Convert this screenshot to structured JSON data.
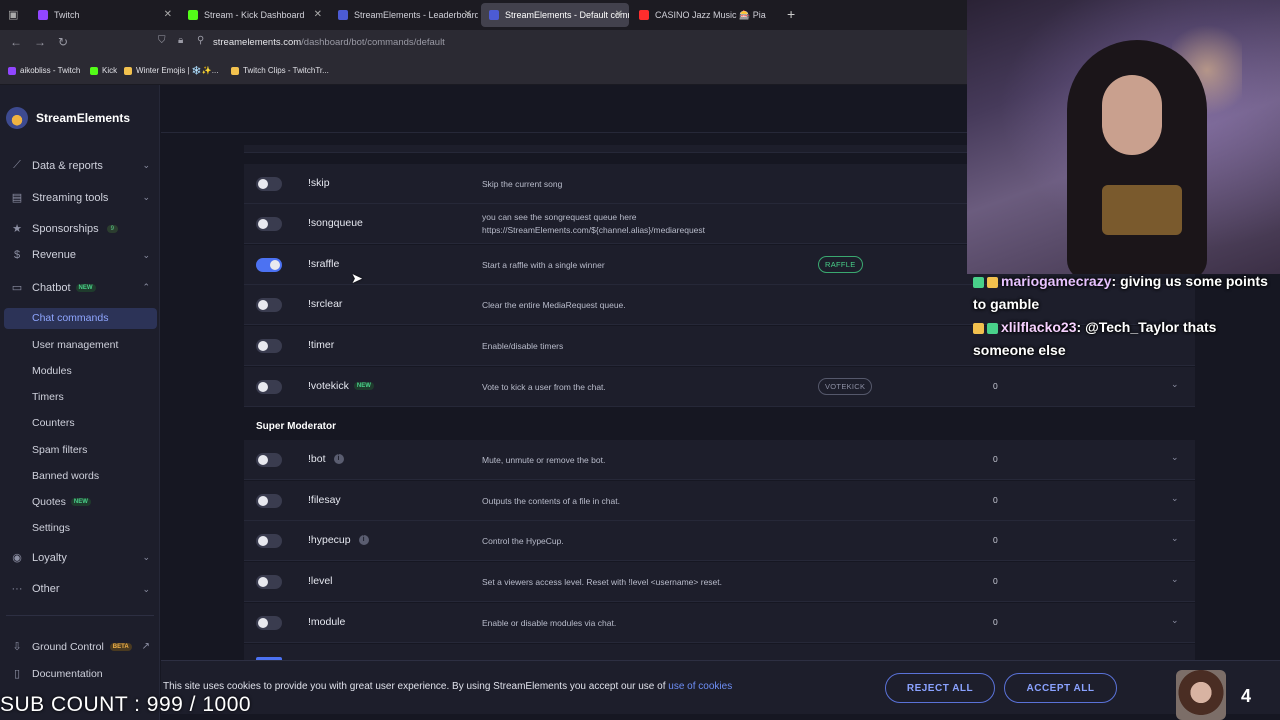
{
  "browser": {
    "tabs": [
      {
        "label": "Twitch",
        "color": "#9146ff"
      },
      {
        "label": "Stream - Kick Dashboard",
        "color": "#53fc18"
      },
      {
        "label": "StreamElements - Leaderboard",
        "color": "#4c5bd4"
      },
      {
        "label": "StreamElements - Default comm",
        "color": "#4c5bd4"
      },
      {
        "label": "CASINO Jazz Music 🎰 Pia",
        "color": "#ff2d2d"
      }
    ],
    "url_host": "streamelements.com",
    "url_path": "/dashboard/bot/commands/default",
    "bookmarks": [
      {
        "label": "aikobliss - Twitch",
        "color": "#9146ff"
      },
      {
        "label": "Kick",
        "color": "#53fc18"
      },
      {
        "label": "Winter Emojis | ❄️✨...",
        "color": "#f2c14e"
      },
      {
        "label": "Twitch Clips - TwitchTr...",
        "color": "#f2c14e"
      }
    ]
  },
  "sidebar": {
    "brand": "StreamElements",
    "sections": [
      {
        "label": "Data & reports",
        "icon": "chart-icon"
      },
      {
        "label": "Streaming tools",
        "icon": "tools-icon"
      },
      {
        "label": "Sponsorships",
        "icon": "star-icon",
        "count": "9"
      },
      {
        "label": "Revenue",
        "icon": "dollar-icon"
      },
      {
        "label": "Chatbot",
        "icon": "chat-icon",
        "badge": "NEW"
      }
    ],
    "chatbot_items": [
      {
        "label": "Chat commands"
      },
      {
        "label": "User management"
      },
      {
        "label": "Modules"
      },
      {
        "label": "Timers"
      },
      {
        "label": "Counters"
      },
      {
        "label": "Spam filters"
      },
      {
        "label": "Banned words"
      },
      {
        "label": "Quotes",
        "badge": "NEW"
      },
      {
        "label": "Settings"
      }
    ],
    "loyalty": "Loyalty",
    "other": "Other",
    "ground_control": "Ground Control",
    "ground_control_badge": "BETA",
    "documentation": "Documentation"
  },
  "commands_top": [
    {
      "name": "!skip",
      "desc": "Skip the current song",
      "enabled": false
    },
    {
      "name": "!songqueue",
      "desc": "you can see the songrequest queue here https://StreamElements.com/${channel.alias}/mediarequest",
      "enabled": false
    },
    {
      "name": "!sraffle",
      "desc": "Start a raffle with a single winner",
      "enabled": true,
      "pill": "RAFFLE"
    },
    {
      "name": "!srclear",
      "desc": "Clear the entire MediaRequest queue.",
      "enabled": false
    },
    {
      "name": "!timer",
      "desc": "Enable/disable timers",
      "enabled": false
    },
    {
      "name": "!votekick",
      "desc": "Vote to kick a user from the chat.",
      "enabled": false,
      "badge": "NEW",
      "pill": "VOTEKICK",
      "level": "0"
    }
  ],
  "super_moderator_heading": "Super Moderator",
  "commands_super": [
    {
      "name": "!bot",
      "desc": "Mute, unmute or remove the bot.",
      "enabled": false,
      "info": true,
      "level": "0"
    },
    {
      "name": "!filesay",
      "desc": "Outputs the contents of a file in chat.",
      "enabled": false,
      "level": "0"
    },
    {
      "name": "!hypecup",
      "desc": "Control the HypeCup.",
      "enabled": false,
      "info": true,
      "level": "0"
    },
    {
      "name": "!level",
      "desc": "Set a viewers access level. Reset with !level <username> reset.",
      "enabled": false,
      "level": "0"
    },
    {
      "name": "!module",
      "desc": "Enable or disable modules via chat.",
      "enabled": false,
      "level": "0"
    }
  ],
  "chat_overlay": [
    {
      "user": "mariogamecrazy",
      "message": "giving us some points to gamble"
    },
    {
      "user": "xlilflacko23",
      "message": "@Tech_Taylor thats someone else"
    }
  ],
  "cookie": {
    "text": "This site uses cookies to provide you with great user experience. By using StreamElements you accept our use of",
    "link": "use of cookies",
    "reject": "REJECT ALL",
    "accept": "ACCEPT ALL"
  },
  "stream_overlay": {
    "sub_count": "SUB COUNT : 999 / 1000",
    "viewer_count": "4"
  }
}
